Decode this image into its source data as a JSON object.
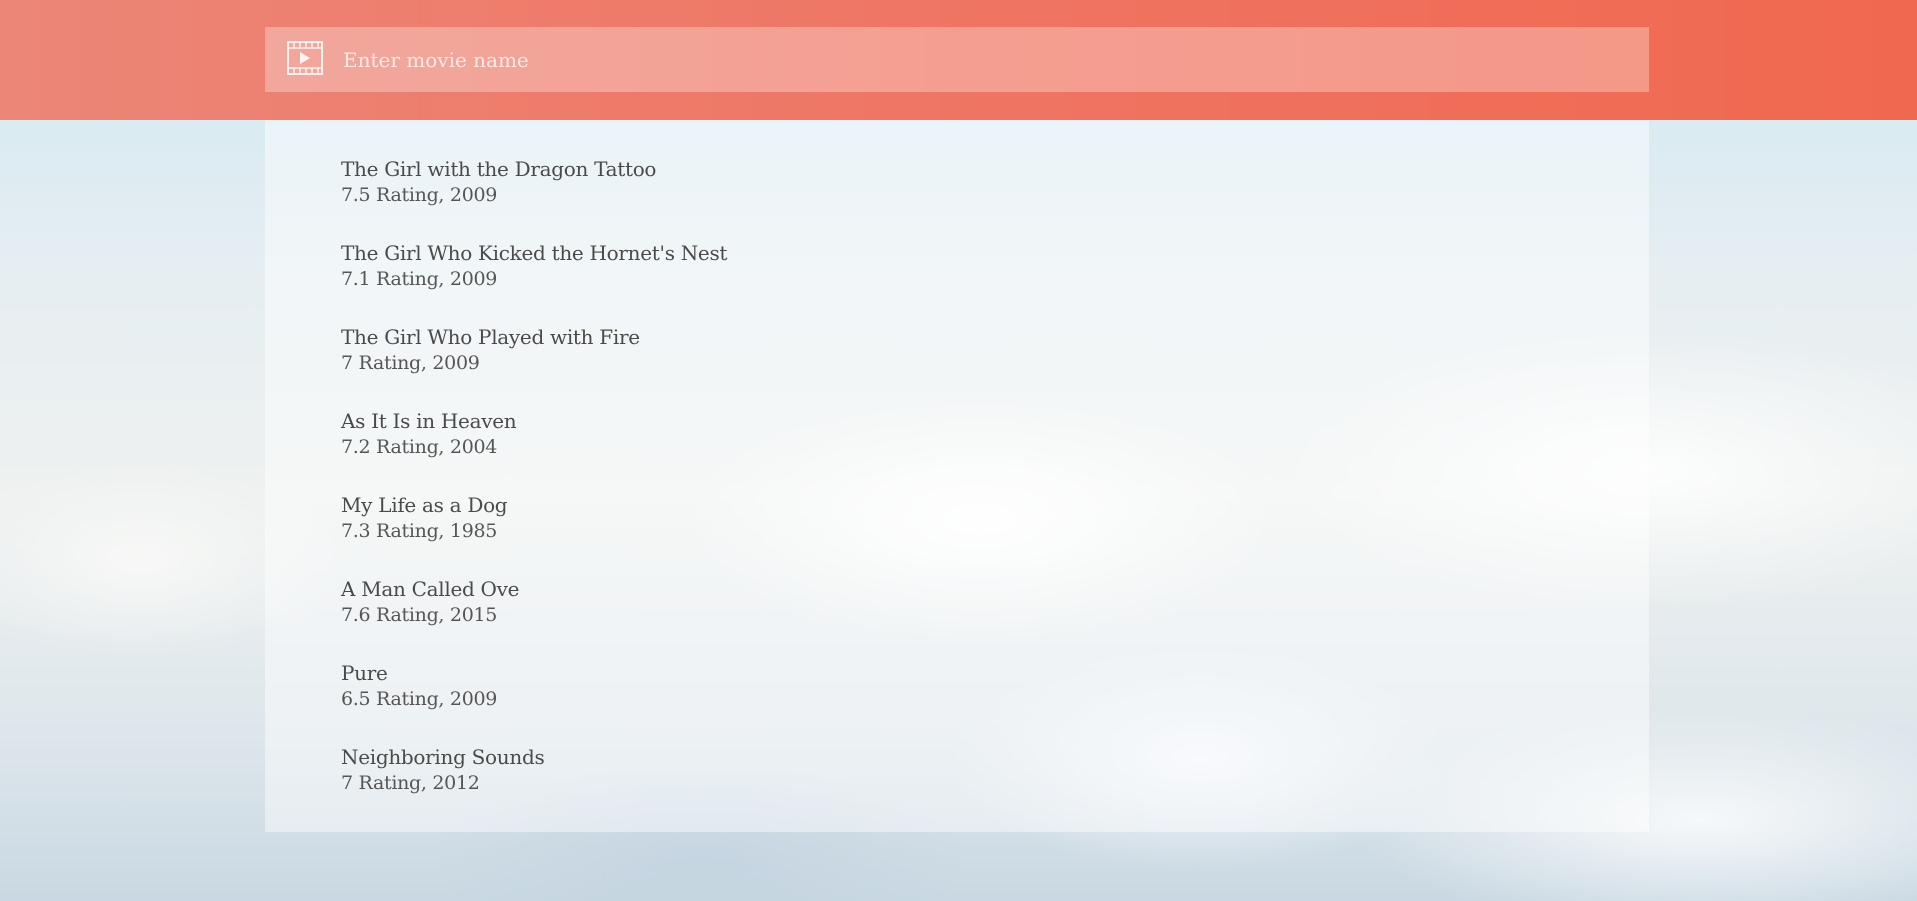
{
  "search": {
    "placeholder": "Enter movie name",
    "value": "",
    "icon": "film-play-icon"
  },
  "colors": {
    "header_gradient": [
      "#ec8677",
      "#f0684f"
    ],
    "text": "#4a4a4a"
  },
  "results": [
    {
      "title": "The Girl with the Dragon Tattoo",
      "meta": "7.5 Rating, 2009"
    },
    {
      "title": "The Girl Who Kicked the Hornet's Nest",
      "meta": "7.1 Rating, 2009"
    },
    {
      "title": "The Girl Who Played with Fire",
      "meta": "7 Rating, 2009"
    },
    {
      "title": "As It Is in Heaven",
      "meta": "7.2 Rating, 2004"
    },
    {
      "title": "My Life as a Dog",
      "meta": "7.3 Rating, 1985"
    },
    {
      "title": "A Man Called Ove",
      "meta": "7.6 Rating, 2015"
    },
    {
      "title": "Pure",
      "meta": "6.5 Rating, 2009"
    },
    {
      "title": "Neighboring Sounds",
      "meta": "7 Rating, 2012"
    }
  ]
}
